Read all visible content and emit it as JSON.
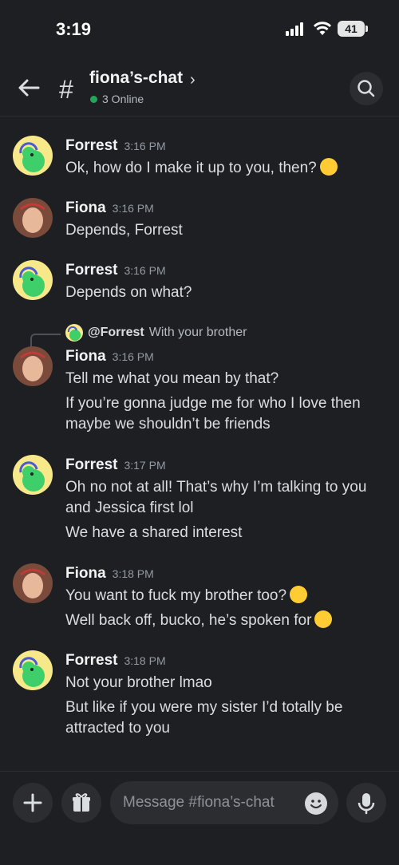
{
  "status": {
    "time": "3:19",
    "battery": "41"
  },
  "header": {
    "channel": "fiona’s-chat",
    "online": "3 Online"
  },
  "messages": [
    {
      "author": "Forrest",
      "time": "3:16 PM",
      "lines": [
        "Ok, how do I make it up to you, then?"
      ]
    },
    {
      "author": "Fiona",
      "time": "3:16 PM",
      "lines": [
        "Depends, Forrest"
      ]
    },
    {
      "author": "Forrest",
      "time": "3:16 PM",
      "lines": [
        "Depends on what?"
      ]
    },
    {
      "reply": {
        "name": "@Forrest",
        "text": "With your brother"
      },
      "author": "Fiona",
      "time": "3:16 PM",
      "lines": [
        "Tell me what you mean by that?",
        "If you’re gonna judge me for who I love then",
        "maybe we shouldn’t be friends"
      ]
    },
    {
      "author": "Forrest",
      "time": "3:17 PM",
      "lines": [
        "Oh no not at all! That’s why I’m talking to you",
        "and Jessica first lol",
        "We have a shared interest"
      ]
    },
    {
      "author": "Fiona",
      "time": "3:18 PM",
      "lines": [
        "You want to fuck my brother too?",
        "Well back off, bucko, he’s spoken for"
      ]
    },
    {
      "author": "Forrest",
      "time": "3:18 PM",
      "lines": [
        "Not your brother lmao",
        "But like if you were my sister I’d totally be",
        "attracted to you"
      ]
    }
  ],
  "composer": {
    "placeholder": "Message #fiona’s-chat"
  },
  "colors": {
    "online": "#23a55a",
    "background": "#1e1f22",
    "surface": "#2b2d31"
  }
}
